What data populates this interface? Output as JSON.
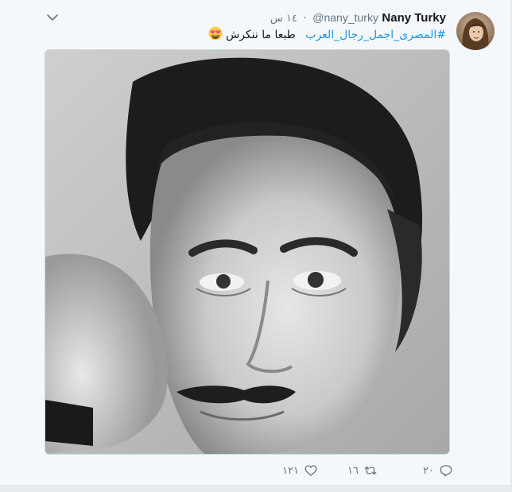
{
  "tweet": {
    "fullname": "Nany Turky",
    "handle": "@nany_turky",
    "separator": "·",
    "time": "١٤ س",
    "hashtag": "#المصرى_اجمل_رجال_العرب",
    "body": "طبعا ما ننكرش",
    "emoji": "heart-eyes-emoji"
  },
  "actions": {
    "reply_count": "٢٠",
    "retweet_count": "١٦",
    "like_count": "١٢١"
  },
  "icons": {
    "menu": "chevron-down-icon",
    "reply": "reply-icon",
    "retweet": "retweet-icon",
    "like": "heart-icon"
  },
  "colors": {
    "link": "#1b95e0",
    "muted": "#657786",
    "text": "#14171a"
  }
}
